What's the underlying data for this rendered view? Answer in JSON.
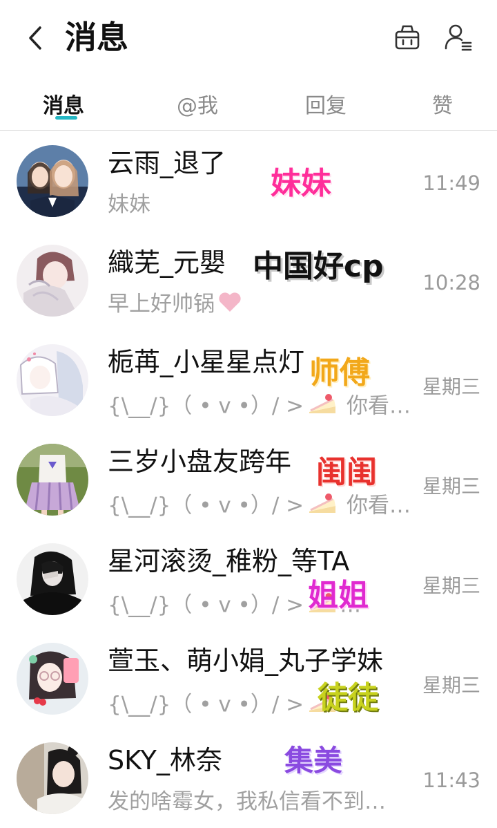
{
  "header": {
    "back_icon": "chevron-left-icon",
    "title": "消息",
    "shop_icon": "basket-icon",
    "contacts_icon": "user-list-icon"
  },
  "tabs": [
    {
      "label": "消息",
      "active": true
    },
    {
      "label": "@我",
      "active": false
    },
    {
      "label": "回复",
      "active": false
    },
    {
      "label": "赞",
      "active": false
    }
  ],
  "accent_color": "#25b7c4",
  "conversations": [
    {
      "name": "云雨_退了",
      "preview": "妹妹",
      "time": "11:49",
      "sticker": "妹妹",
      "sticker_color": "#ff2e9a"
    },
    {
      "name": "織芜_元嬰",
      "preview": "早上好帅锅",
      "preview_icon": "heart-icon",
      "time": "10:28",
      "sticker": "中国好cp",
      "sticker_color": "#111111"
    },
    {
      "name": "栀苒_小星星点灯",
      "preview": "{\\__/}（ • v •）/ >",
      "preview_icon": "cake-icon",
      "preview_tail": "你看…",
      "time": "星期三",
      "sticker": "师傅",
      "sticker_color": "#f2a81a"
    },
    {
      "name": "三岁小盘友跨年",
      "preview": "{\\__/}（ • v •）/ >",
      "preview_icon": "cake-icon",
      "preview_tail": "你看…",
      "time": "星期三",
      "sticker": "闺闺",
      "sticker_color": "#e8322e"
    },
    {
      "name": "星河滚烫_稚粉_等TA",
      "preview": "{\\__/}（ • v •）/ >",
      "preview_icon": "cake-icon",
      "preview_tail": "…",
      "time": "星期三",
      "sticker": "姐姐",
      "sticker_color": "#e02ad0"
    },
    {
      "name": "萱玉、萌小娟_丸子学妹",
      "preview": "{\\__/}（ • v •）/ >",
      "preview_icon": "cake-icon",
      "preview_tail": "",
      "time": "星期三",
      "sticker": "徒徒",
      "sticker_color": "#c8d21e"
    },
    {
      "name": "SKY_林奈",
      "preview": "发的啥霉女，我私信看不到…",
      "time": "11:43",
      "sticker": "集美",
      "sticker_color": "#8a4ae0"
    }
  ]
}
